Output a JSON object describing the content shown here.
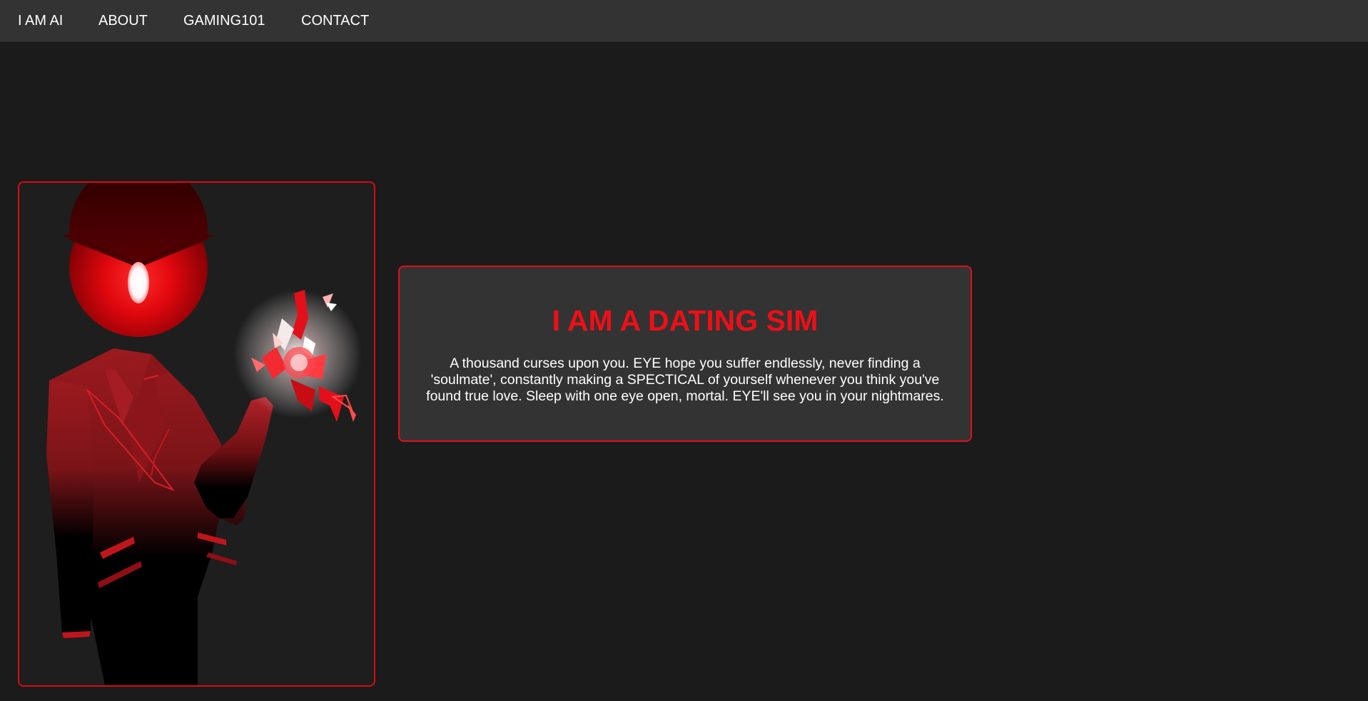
{
  "nav": {
    "items": [
      {
        "label": "I AM AI"
      },
      {
        "label": "ABOUT"
      },
      {
        "label": "GAMING101"
      },
      {
        "label": "CONTACT"
      }
    ]
  },
  "hero": {
    "title": "I AM A DATING SIM",
    "body": "A thousand curses upon you. EYE hope you suffer endlessly, never finding a 'soulmate', constantly making a SPECTICAL of yourself whenever you think you've found true love. Sleep with one eye open, mortal. EYE'll see you in your nightmares."
  },
  "colors": {
    "accent": "#e0101a",
    "background": "#1b1b1b",
    "navbar": "#333333",
    "card": "#333333",
    "text": "#ffffff"
  },
  "icons": {
    "portrait": "red-eye-suited-figure-illustration"
  }
}
